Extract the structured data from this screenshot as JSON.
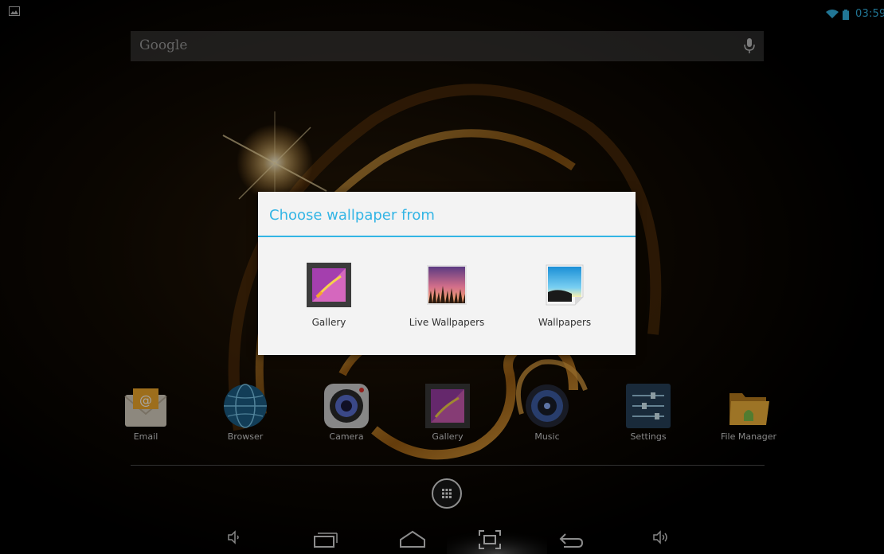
{
  "status_bar": {
    "time": "03:59"
  },
  "search": {
    "label": "Google"
  },
  "workspace_apps": [
    {
      "label": "Email",
      "icon": "email-icon"
    },
    {
      "label": "Browser",
      "icon": "browser-globe-icon"
    },
    {
      "label": "Camera",
      "icon": "camera-icon"
    },
    {
      "label": "Gallery",
      "icon": "gallery-icon"
    },
    {
      "label": "Music",
      "icon": "music-icon"
    },
    {
      "label": "Settings",
      "icon": "settings-sliders-icon"
    },
    {
      "label": "File Manager",
      "icon": "file-manager-folder-icon"
    }
  ],
  "dialog": {
    "title": "Choose wallpaper from",
    "options": [
      {
        "label": "Gallery",
        "icon": "gallery-icon"
      },
      {
        "label": "Live Wallpapers",
        "icon": "live-wallpapers-icon"
      },
      {
        "label": "Wallpapers",
        "icon": "wallpapers-icon"
      }
    ]
  },
  "navigation": [
    "volume-down-icon",
    "recent-apps-icon",
    "home-icon",
    "screenshot-icon",
    "back-icon",
    "volume-up-icon"
  ],
  "colors": {
    "accent": "#33b5e5",
    "dialog_bg": "#f3f3f3",
    "title_text": "#33b5e5"
  }
}
